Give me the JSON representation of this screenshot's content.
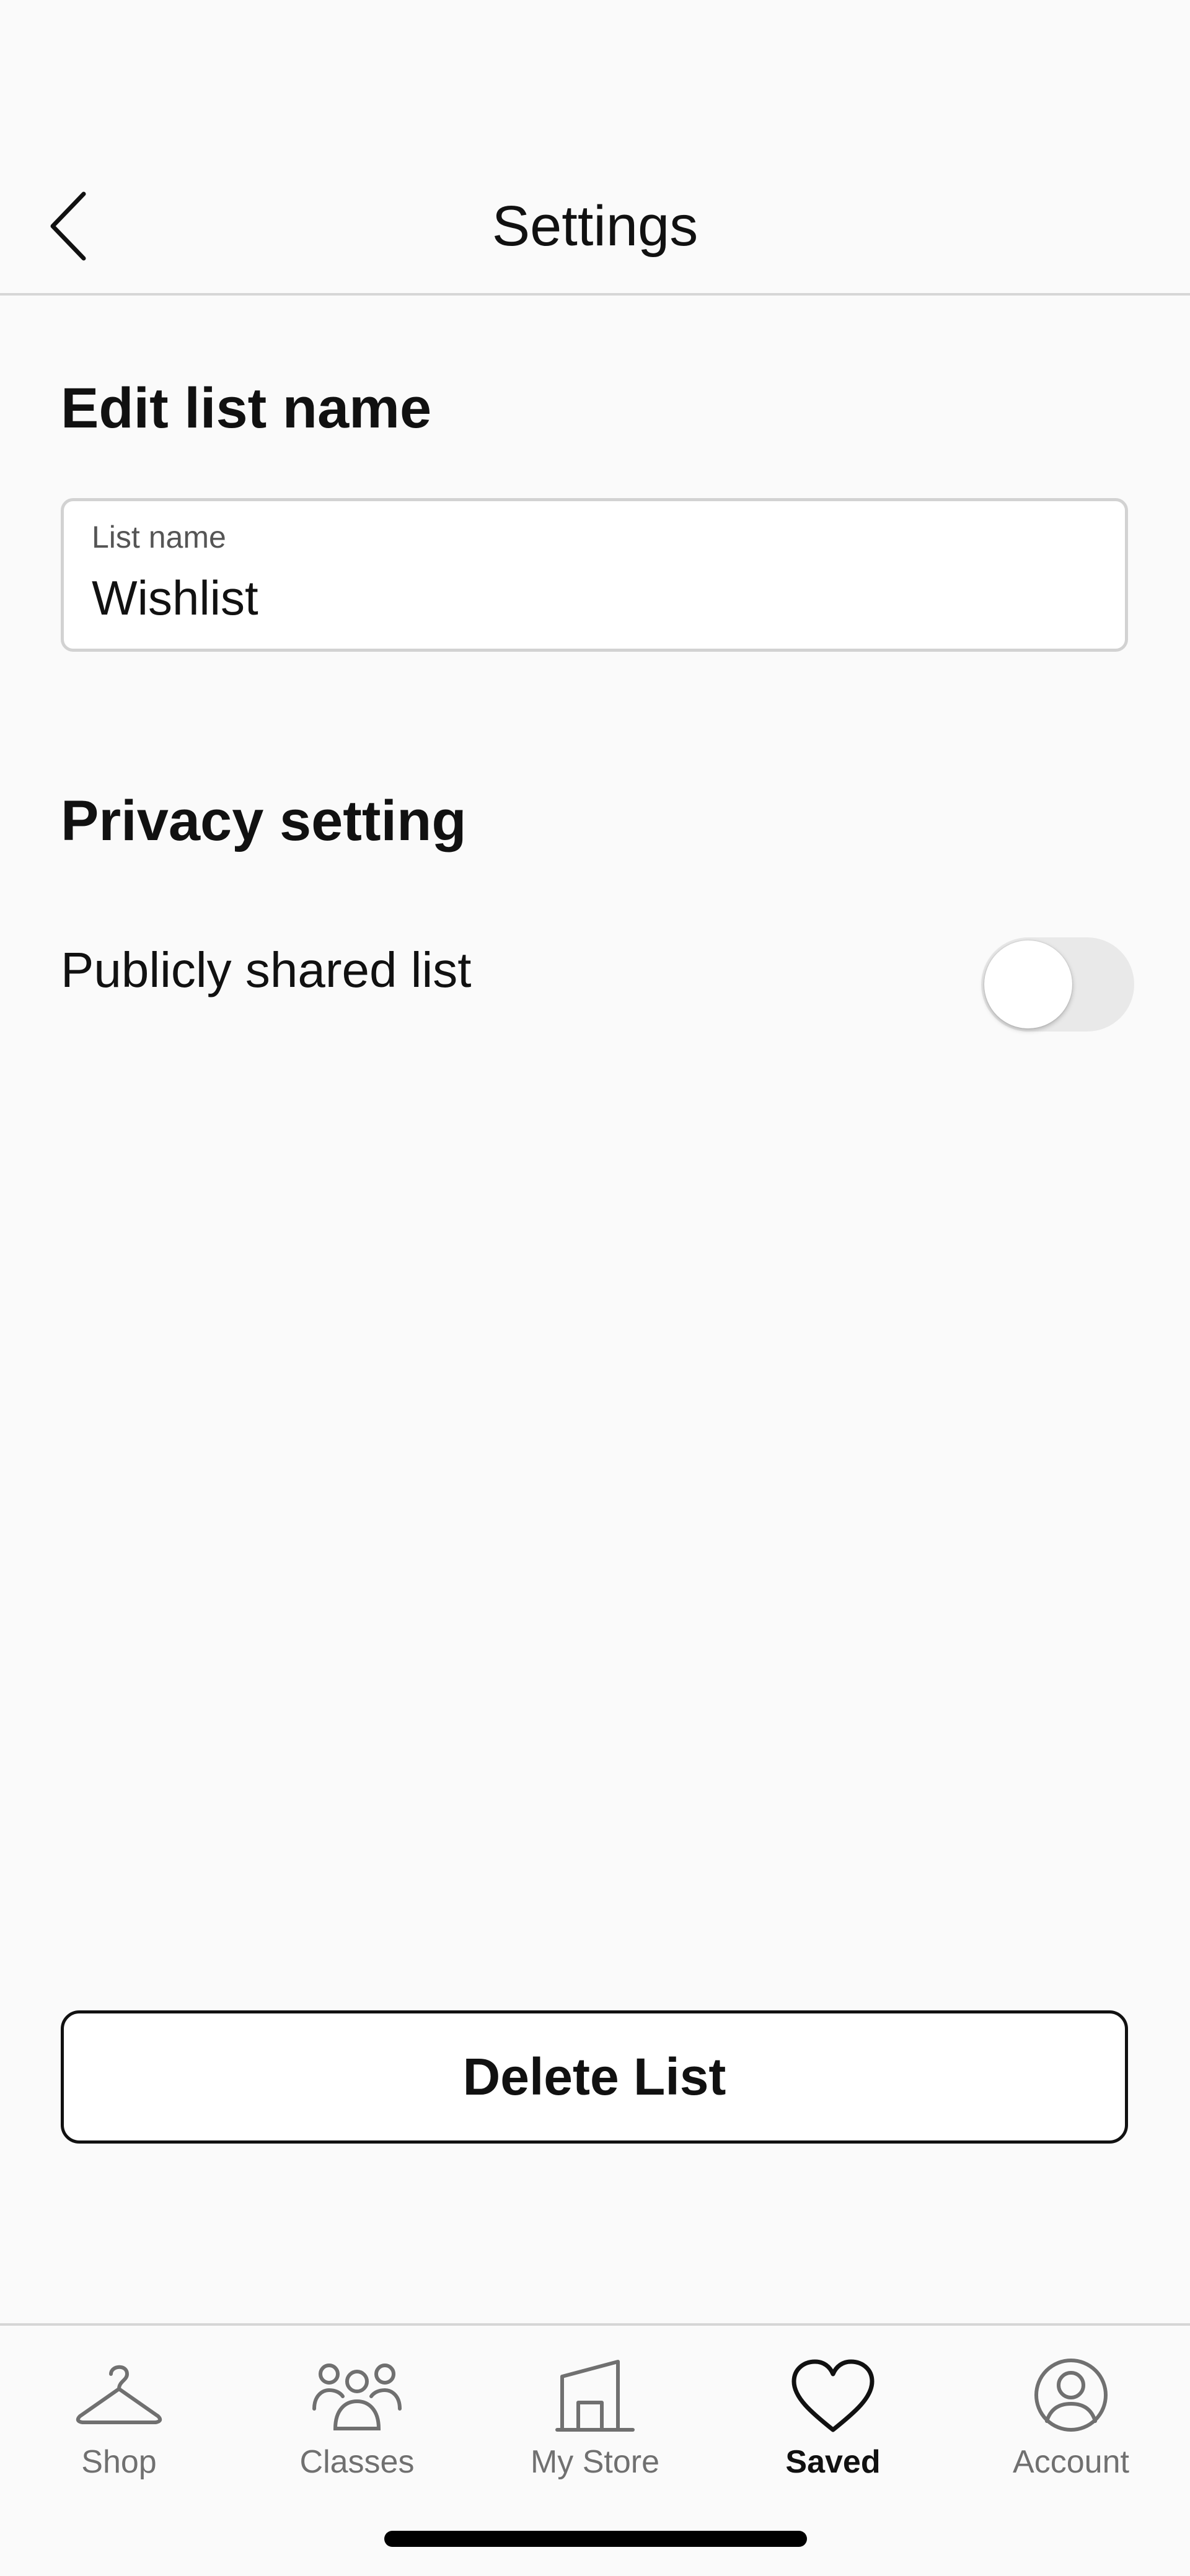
{
  "header": {
    "title": "Settings",
    "back_icon": "chevron-left-icon"
  },
  "edit_section": {
    "title": "Edit list name",
    "field_label": "List name",
    "field_value": "Wishlist"
  },
  "privacy_section": {
    "title": "Privacy setting",
    "toggle_label": "Publicly shared list",
    "toggle_on": false
  },
  "delete_button": {
    "label": "Delete List"
  },
  "tabbar": {
    "items": [
      {
        "label": "Shop",
        "icon": "hanger-icon",
        "active": false
      },
      {
        "label": "Classes",
        "icon": "people-icon",
        "active": false
      },
      {
        "label": "My Store",
        "icon": "store-icon",
        "active": false
      },
      {
        "label": "Saved",
        "icon": "heart-icon",
        "active": true
      },
      {
        "label": "Account",
        "icon": "user-icon",
        "active": false
      }
    ]
  },
  "colors": {
    "background": "#fafafa",
    "text": "#111111",
    "inactive_tab": "#707070",
    "divider": "#d6d6d6",
    "toggle_off": "#e9e9e9"
  }
}
